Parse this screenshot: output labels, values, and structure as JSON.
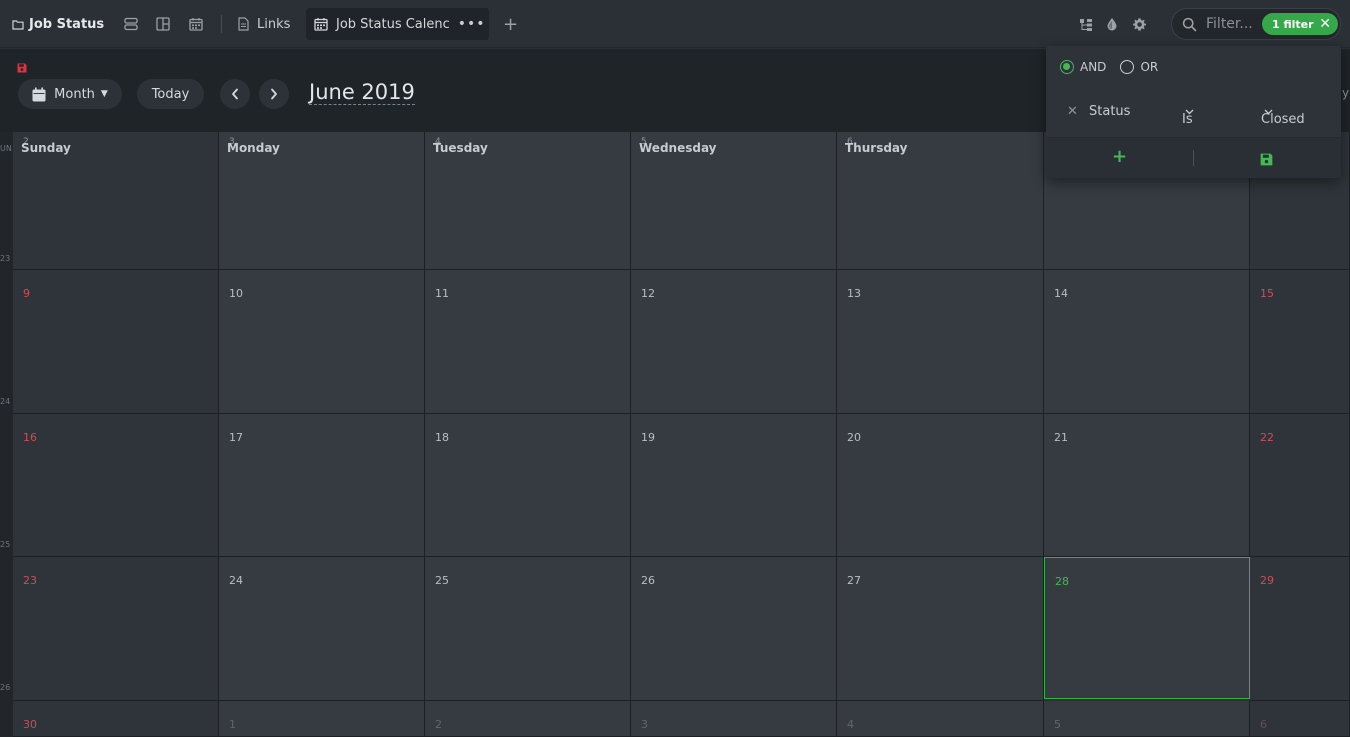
{
  "topbar": {
    "workspace_title": "Job Status",
    "tab_links_label": "Links",
    "tab_active_label": "Job Status Calenc",
    "tab_active_more": "•••",
    "add_tab": "+",
    "search_placeholder": "Filter...",
    "filter_count_label": "1 filter",
    "filter_clear": "✕"
  },
  "toolbar": {
    "view_label": "Month",
    "today_label": "Today",
    "period_title": "June 2019"
  },
  "calendar": {
    "weekdays": [
      "Sunday",
      "Monday",
      "Tuesday",
      "Wednesday",
      "Thursday"
    ],
    "first_row_dates": [
      "2",
      "3",
      "4",
      "5",
      "6"
    ],
    "week_numbers": [
      "UN",
      "23",
      "24",
      "25",
      "26"
    ],
    "weeks": [
      [
        "9",
        "10",
        "11",
        "12",
        "13",
        "14",
        "15"
      ],
      [
        "16",
        "17",
        "18",
        "19",
        "20",
        "21",
        "22"
      ],
      [
        "23",
        "24",
        "25",
        "26",
        "27",
        "28",
        "29"
      ],
      [
        "30",
        "1",
        "2",
        "3",
        "4",
        "5",
        "6"
      ]
    ],
    "today": "28"
  },
  "filter_popup": {
    "and_label": "AND",
    "or_label": "OR",
    "mode": "AND",
    "rule": {
      "field": "Status",
      "operator": "Is",
      "value": "Closed"
    },
    "add_label": "+"
  },
  "colors": {
    "accent_green": "#35a94a",
    "weekend_red": "#c94e57",
    "save_red": "#d9343f"
  },
  "edge_text": "y"
}
